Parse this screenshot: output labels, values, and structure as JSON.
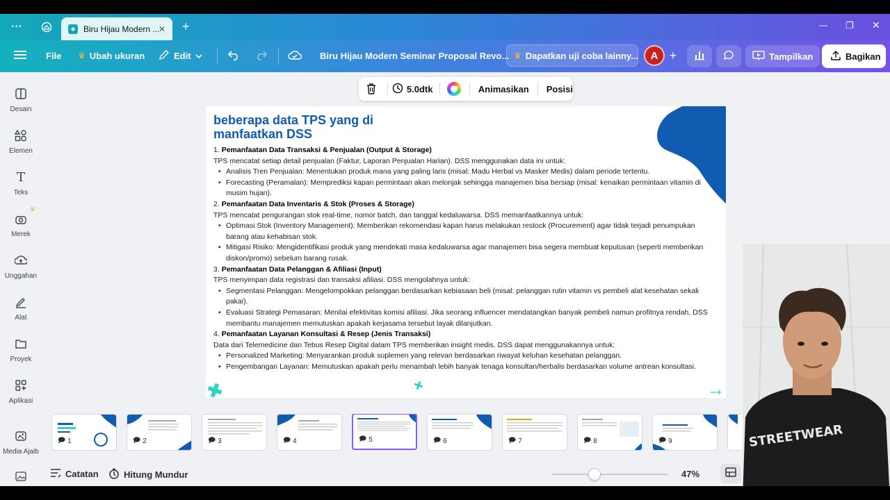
{
  "browser": {
    "tab_title": "Biru Hijau Modern ...",
    "new_tab_symbol": "+",
    "window_controls": {
      "minimize": "—",
      "restore": "❐",
      "close": "✕"
    }
  },
  "toolbar": {
    "file_label": "File",
    "resize_label": "Ubah ukuran",
    "edit_label": "Edit",
    "doc_title": "Biru Hijau Modern Seminar Proposal Revo...",
    "trial_label": "Dapatkan uji coba lainny...",
    "avatar_letter": "A",
    "present_label": "Tampilkan",
    "share_label": "Bagikan"
  },
  "sidebar": {
    "items": [
      {
        "label": "Desain",
        "icon": "layout-icon"
      },
      {
        "label": "Elemen",
        "icon": "shapes-icon"
      },
      {
        "label": "Teks",
        "icon": "text-icon"
      },
      {
        "label": "Merek",
        "icon": "brand-icon"
      },
      {
        "label": "Unggahan",
        "icon": "upload-icon"
      },
      {
        "label": "Alat",
        "icon": "draw-icon"
      },
      {
        "label": "Proyek",
        "icon": "folder-icon"
      },
      {
        "label": "Aplikasi",
        "icon": "apps-icon"
      },
      {
        "label": "Media Ajaib",
        "icon": "magic-media-icon"
      }
    ]
  },
  "floatbar": {
    "duration": "5.0dtk",
    "animate_label": "Animasikan",
    "position_label": "Posisi"
  },
  "slide": {
    "title_line1": "beberapa data TPS yang di",
    "title_line2": "manfaatkan DSS",
    "sections": [
      {
        "num": "1.",
        "heading": "Pemanfaatan Data Transaksi & Penjualan (Output & Storage)",
        "intro": "TPS mencatat setiap detail penjualan (Faktur, Laporan Penjualan Harian). DSS menggunakan data ini untuk:",
        "bullets": [
          "Analisis Tren Penjualan: Menentukan produk mana yang paling laris (misal: Madu Herbal vs Masker Medis) dalam periode tertentu.",
          "Forecasting (Peramalan): Memprediksi kapan permintaan akan melonjak sehingga manajemen bisa bersiap (misal: kenaikan permintaan vitamin di musim hujan)."
        ]
      },
      {
        "num": "2.",
        "heading": "Pemanfaatan Data Inventaris & Stok (Proses & Storage)",
        "intro": "TPS mencatat pengurangan stok real-time, nomor batch, dan tanggal kedaluwarsa. DSS memanfaatkannya untuk:",
        "bullets": [
          "Optimasi Stok (Inventory Management): Memberikan rekomendasi kapan harus melakukan restock (Procurement) agar tidak terjadi penumpukan barang atau kehabisan stok.",
          "Mitigasi Risiko: Mengidentifikasi produk yang mendekati masa kedaluwarsa agar manajemen bisa segera membuat keputusan (seperti memberikan diskon/promo) sebelum barang rusak."
        ]
      },
      {
        "num": "3.",
        "heading": "Pemanfaatan Data Pelanggan & Afiliasi (Input)",
        "intro": "TPS menyimpan data registrasi dan transaksi afiliasi. DSS mengolahnya untuk:",
        "bullets": [
          "Segmentasi Pelanggan: Mengelompokkan pelanggan berdasarkan kebiasaan beli (misal: pelanggan rutin vitamin vs pembeli alat kesehatan sekali pakai).",
          "Evaluasi Strategi Pemasaran: Menilai efektivitas komisi afiliasi. Jika seorang influencer mendatangkan banyak pembeli namun profitnya rendah, DSS membantu manajemen memutuskan apakah kerjasama tersebut layak dilanjutkan."
        ]
      },
      {
        "num": "4.",
        "heading": "Pemanfaatan Layanan Konsultasi & Resep (Jenis Transaksi)",
        "intro": "Data dari Telemedicine dan Tebus Resep Digital dalam TPS memberikan insight medis. DSS dapat menggunakannya untuk:",
        "bullets": [
          "Personalized Marketing: Menyarankan produk suplemen yang relevan berdasarkan riwayat keluhan kesehatan pelanggan.",
          "Pengembangan Layanan: Memutuskan apakah perlu menambah lebih banyak tenaga konsultan/herbalis berdasarkan volume antrean konsultasi."
        ]
      }
    ]
  },
  "thumbnails": [
    "1",
    "2",
    "3",
    "4",
    "5",
    "6",
    "7",
    "8",
    "9"
  ],
  "selected_thumbnail": "5",
  "bottombar": {
    "notes_label": "Catatan",
    "timer_label": "Hitung Mundur",
    "zoom": "47%",
    "zoom_level": 0.47
  },
  "colors": {
    "brand_blue": "#0f5cb0",
    "accent_teal": "#2fd3c0",
    "selection_purple": "#8b5cf6"
  }
}
